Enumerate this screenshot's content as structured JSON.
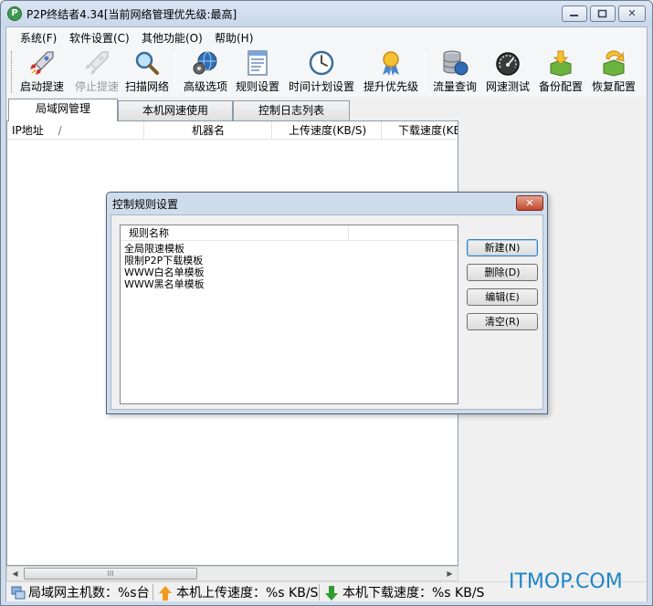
{
  "window": {
    "title": "P2P终结者4.34[当前网络管理优先级:最高]",
    "app_icon": "P",
    "min_glyph": "▭",
    "max_glyph": "□",
    "close_glyph": "✕"
  },
  "menu": [
    {
      "label": "系统(F)"
    },
    {
      "label": "软件设置(C)"
    },
    {
      "label": "其他功能(O)"
    },
    {
      "label": "帮助(H)"
    }
  ],
  "toolbar": [
    {
      "label": "启动提速",
      "icon": "rocket-icon",
      "enabled": true
    },
    {
      "label": "停止提速",
      "icon": "rocket-stop-icon",
      "enabled": false
    },
    {
      "label": "扫描网络",
      "icon": "magnifier-icon",
      "enabled": true
    },
    {
      "label": "高级选项",
      "icon": "globe-gear-icon",
      "enabled": true
    },
    {
      "label": "规则设置",
      "icon": "document-rules-icon",
      "enabled": true
    },
    {
      "label": "时间计划设置",
      "icon": "clock-icon",
      "enabled": true
    },
    {
      "label": "提升优先级",
      "icon": "award-ribbon-icon",
      "enabled": true
    },
    {
      "label": "流量查询",
      "icon": "database-globe-icon",
      "enabled": true
    },
    {
      "label": "网速测试",
      "icon": "speedometer-icon",
      "enabled": true
    },
    {
      "label": "备份配置",
      "icon": "box-download-icon",
      "enabled": true
    },
    {
      "label": "恢复配置",
      "icon": "box-restore-icon",
      "enabled": true
    }
  ],
  "tabs": [
    {
      "label": "局域网管理",
      "active": true
    },
    {
      "label": "本机网速使用",
      "active": false
    },
    {
      "label": "控制日志列表",
      "active": false
    }
  ],
  "hostlist": {
    "columns": [
      "IP地址",
      "机器名",
      "上传速度(KB/S)",
      "下载速度(KB"
    ],
    "sort_glyph": "/"
  },
  "scrollbar": {
    "left": "◀",
    "right": "▶",
    "thumb": "III"
  },
  "statusbar": {
    "hosts": "局域网主机数：%s台",
    "upload": "本机上传速度：%s KB/S",
    "download": "本机下载速度：%s KB/S"
  },
  "watermark": "ITMOP.COM",
  "dialog": {
    "title": "控制规则设置",
    "close_glyph": "✕",
    "column": "规则名称",
    "rules": [
      "全局限速模板",
      "限制P2P下载模板",
      "WWW白名单模板",
      "WWW黑名单模板"
    ],
    "buttons": [
      "新建(N)",
      "删除(D)",
      "编辑(E)",
      "清空(R)"
    ]
  },
  "colors": {
    "accent": "#1f86c6",
    "upload_arrow": "#f29a1d",
    "download_arrow": "#2f9a2f"
  }
}
